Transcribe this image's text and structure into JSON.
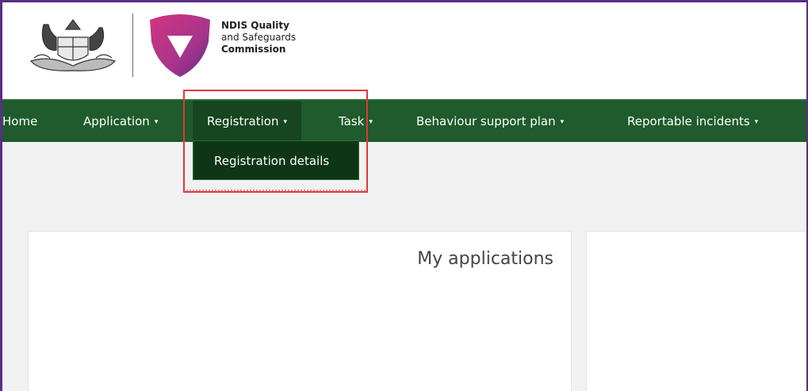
{
  "logo": {
    "line1": "NDIS Quality",
    "line2": "and Safeguards",
    "line3": "Commission",
    "coat_of_arms_icon": "coat-of-arms-icon",
    "shield_icon": "ndis-shield-icon"
  },
  "nav": {
    "items": [
      {
        "label": "Home",
        "has_dropdown": false
      },
      {
        "label": "Application",
        "has_dropdown": true
      },
      {
        "label": "Registration",
        "has_dropdown": true,
        "active": true
      },
      {
        "label": "Task",
        "has_dropdown": true
      },
      {
        "label": "Behaviour support plan",
        "has_dropdown": true
      },
      {
        "label": "Reportable incidents",
        "has_dropdown": true
      }
    ],
    "caret": "▾"
  },
  "dropdown": {
    "items": [
      {
        "label": "Registration details"
      }
    ]
  },
  "cards": {
    "my_applications_title": "My applications"
  },
  "colors": {
    "nav_bg": "#1f5b2c",
    "dropdown_bg": "#0f3517",
    "highlight_border": "#e0373a",
    "frame": "#5b2d86"
  }
}
